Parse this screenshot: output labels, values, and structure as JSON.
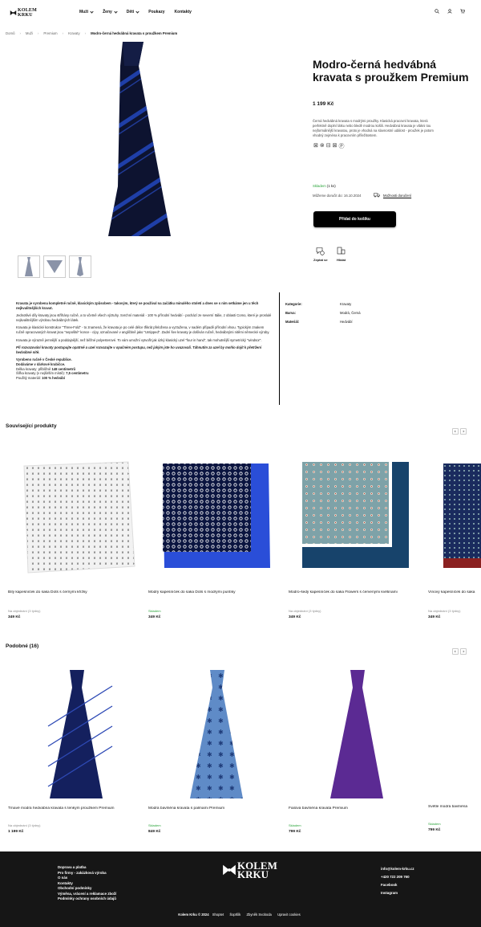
{
  "header": {
    "logo": "KOLEM KRKU",
    "logo_line1": "KOLEM",
    "logo_line2": "KRKU",
    "nav": [
      {
        "label": "Muži",
        "dropdown": true
      },
      {
        "label": "Ženy",
        "dropdown": true
      },
      {
        "label": "Děti",
        "dropdown": true
      },
      {
        "label": "Poukazy",
        "dropdown": false
      },
      {
        "label": "Kontakty",
        "dropdown": false
      }
    ],
    "icons": [
      "search-icon",
      "user-icon",
      "cart-icon"
    ]
  },
  "breadcrumb": [
    "Domů",
    "Muži",
    "Premium",
    "Kravaty",
    "Modro-černá hedvábná kravata s proužkem Premium"
  ],
  "product": {
    "title": "Modro-černá hedvábná kravata s proužkem Premium",
    "price": "1 199 Kč",
    "description": "Černá hedvábná kravata s modrými proužky. Klasická pracovní kravata, která perfektně doplní látku nebo bledě modrou košili. Hedvábná kravata je vlákni tou nejformálnější kravatou, proto je vhodná na slavnostní událost - proužek je potom vhodný zejména k pracovním příležitostem.",
    "stock": "Skladem",
    "stock_count": "(1 ks)",
    "delivery": "Můžeme doručit do: 16.10.2024",
    "delivery_link": "Možnosti doručení",
    "add_to_cart": "Přidat do košíku",
    "ask": "Zeptat se",
    "watch": "Hlídat",
    "colors": {
      "tie_base": "#0d1330",
      "tie_stripe": "#1f3fa8",
      "accent_green": "#2aa43a"
    }
  },
  "details": {
    "intro": "Kravata je vyrobena kompletně ručně, klasickým způsobem - takovým, který se používal na začátku minulého století a dnes se s ním setkáme jen u těch nejkvalitnějších kravat.",
    "p1": "Jednotlivé díly kravaty jsou stříhány ručně, a to včetně všech výztuhy. Svrchní materiál - 100 % přírodní hedvábí - pochází ze severní Itálie, z oblasti Como, které je proslulé nejkvalitnějším výrobou hedvábných látek.",
    "p2": "Kravata je klasické konstrukce \"Three-Fold\" - to znamená, že kravata je po celé délce třikrát přeložena a vyztužena, v nadém případě přírodní vlnou. Typickým znakem ručně opracovaných kravat jsou \"nepošité\" konce - cípy, označované v angličtině jako \"Untipped\". Zadní šev kravaty je došíván ručně, hedvábnými nitěmi německé výroby.",
    "p3": "Kravata je výrazně jemnější a poddajnější, než běžné polyesterové. To vám umožní vytvořit jak úzký klasický uzel \"four in hand\", tak mohutnější symetrický \"windsor\".",
    "p4": "Při rozvazování kravaty postupujte opatrně a uzel rozvazujte v opačném postupu, než jakým jste ho uvazovali. Táhnutím za uzel by mohlo dojít k přetržení hedvábné nitě.",
    "l1": "Vyrobeno ručně v České republice.",
    "l2": "Dodáváme v dárkové krabičce.",
    "l3_a": "Délka kravaty: přibližně ",
    "l3_b": "148 centimetrů",
    "l4_a": "Šířka kravaty (v nejširším místě): ",
    "l4_b": "7,5 centimetru",
    "l5_a": "Použitý materiál: ",
    "l5_b": "100 % hedvábí",
    "attributes": [
      {
        "key": "Kategorie:",
        "value": "Kravaty"
      },
      {
        "key": "Barva:",
        "value": "Modrá, Černá"
      },
      {
        "key": "Materiál:",
        "value": "Hedvábí"
      }
    ]
  },
  "related": {
    "title": "Související produkty",
    "items": [
      {
        "name": "Bílý kapesníček do saka Dots s černými křížky",
        "stock": "Na objednání (3 týdny)",
        "price": "349 Kč"
      },
      {
        "name": "Modrý kapesníček do saka Dots s modrými puntíky",
        "stock": "Skladem",
        "price": "349 Kč"
      },
      {
        "name": "Modro-šedý kapesníček do saka Flowers s červenými květinami",
        "stock": "Na objednání (3 týdny)",
        "price": "349 Kč"
      },
      {
        "name": "Vínový kapesníček do saka",
        "stock": "Na objednání (3 týdny)",
        "price": "349 Kč"
      }
    ]
  },
  "similar": {
    "title": "Podobné (16)",
    "items": [
      {
        "name": "Tmavě modrá hedvábná kravata s tenkým proužkem Premium",
        "stock": "Na objednání (3 týdny)",
        "price": "1 199 Kč"
      },
      {
        "name": "Modrá bavlněná kravata s palmami Premium",
        "stock": "Skladem",
        "price": "849 Kč"
      },
      {
        "name": "Fialová bavlněná kravata Premium",
        "stock": "Skladem",
        "price": "799 Kč"
      },
      {
        "name": "Světle modrá bavlněná",
        "stock": "Skladem",
        "price": "799 Kč"
      }
    ]
  },
  "footer": {
    "links": [
      "Doprava a platba",
      "Pro firmy - zakázková výroba",
      "O nás",
      "Kontakty",
      "Obchodní podmínky",
      "Výměna, vrácení a reklamace zboží",
      "Podmínky ochrany osobních údajů"
    ],
    "contact": [
      "info@kolem-krku.cz",
      "+420 722 209 760",
      "Facebook",
      "Instagram"
    ],
    "copyright": "Kolem Krku © 2024",
    "bottom_links": [
      "Shoptet",
      "Šoptšík",
      "Zbyněk Svoboda",
      "Upravit cookies"
    ],
    "bg_color": "#161616"
  }
}
